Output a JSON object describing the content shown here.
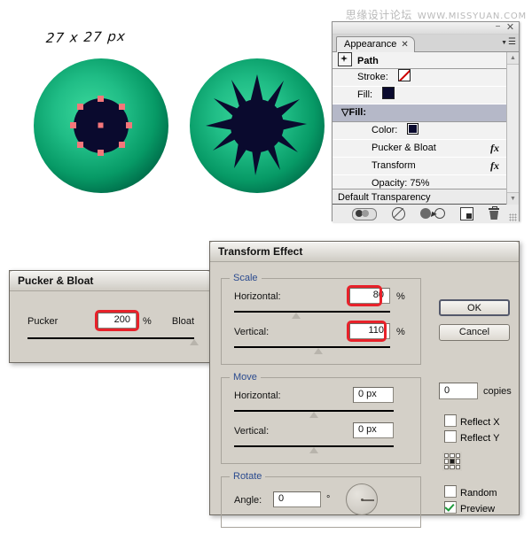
{
  "watermark": {
    "cn": "思缘设计论坛",
    "url": "WWW.MISSYUAN.COM"
  },
  "artwork": {
    "size_label": "27 x 27 px",
    "colors": {
      "iris_center": "#2ecf93",
      "iris_mid": "#14a874",
      "iris_edge": "#007a52",
      "pupil": "#0a0a2e",
      "anchor_point": "#f4767a"
    },
    "eyes": [
      {
        "name": "eye-before",
        "pupil_shape": "circle",
        "anchors_visible": true
      },
      {
        "name": "eye-after",
        "pupil_shape": "starburst",
        "anchors_visible": false
      }
    ]
  },
  "appearance_panel": {
    "tab_label": "Appearance",
    "tab_close_glyph": "✕",
    "minimize_glyph": "−",
    "close_glyph": "✕",
    "menu_caret": "▼",
    "menu_lines": "☰",
    "scroll_up": "▲",
    "scroll_down": "▼",
    "rows": [
      {
        "label": "Path",
        "type": "head",
        "icon": "path-icon"
      },
      {
        "label": "Stroke:",
        "type": "indent1",
        "swatch": "stroke-none"
      },
      {
        "label": "Fill:",
        "type": "indent1",
        "swatch": "fill"
      },
      {
        "label": "Fill:",
        "type": "group",
        "disclosure": "▽"
      },
      {
        "label": "Color:",
        "type": "indent2",
        "swatch": "color"
      },
      {
        "label": "Pucker & Bloat",
        "type": "indent2",
        "fx": "fx"
      },
      {
        "label": "Transform",
        "type": "indent2",
        "fx": "fx"
      },
      {
        "label": "Opacity: 75%",
        "type": "indent2"
      }
    ],
    "default_transparency": "Default Transparency",
    "footer_icons": [
      "new-art-has-basic-appearance-icon",
      "clear-appearance-icon",
      "duplicate-selected-item-icon",
      "add-new-effect-icon",
      "delete-selected-item-icon"
    ]
  },
  "pucker_dialog": {
    "title": "Pucker & Bloat",
    "left_label": "Pucker",
    "right_label": "Bloat",
    "value": "200",
    "unit": "%",
    "slider_percent": 100,
    "highlighted": true
  },
  "transform_dialog": {
    "title": "Transform Effect",
    "groups": {
      "scale": {
        "legend": "Scale",
        "fields": [
          {
            "label": "Horizontal:",
            "value": "80",
            "unit": "%",
            "highlighted": true,
            "slider_percent": 40
          },
          {
            "label": "Vertical:",
            "value": "110",
            "unit": "%",
            "highlighted": true,
            "slider_percent": 50
          }
        ]
      },
      "move": {
        "legend": "Move",
        "fields": [
          {
            "label": "Horizontal:",
            "value": "0 px",
            "unit": "",
            "highlighted": false,
            "slider_percent": 50
          },
          {
            "label": "Vertical:",
            "value": "0 px",
            "unit": "",
            "highlighted": false,
            "slider_percent": 50
          }
        ]
      },
      "rotate": {
        "legend": "Rotate",
        "fields": [
          {
            "label": "Angle:",
            "value": "0",
            "unit": "°",
            "highlighted": false
          }
        ]
      }
    },
    "buttons": {
      "ok": "OK",
      "cancel": "Cancel"
    },
    "copies": {
      "value": "0",
      "label": "copies"
    },
    "checkboxes": [
      {
        "label": "Reflect X",
        "checked": false
      },
      {
        "label": "Reflect Y",
        "checked": false
      },
      {
        "label": "Random",
        "checked": false
      },
      {
        "label": "Preview",
        "checked": true
      }
    ],
    "anchor_grid_selected": "center"
  }
}
